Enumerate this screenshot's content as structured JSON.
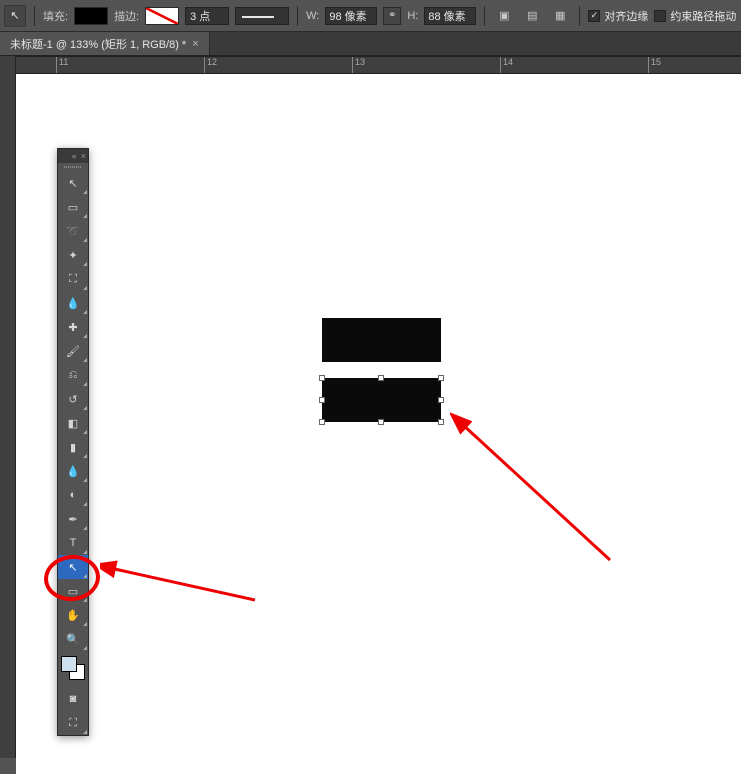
{
  "options": {
    "fill_label": "填充:",
    "stroke_label": "描边:",
    "stroke_width_value": "3 点",
    "w_label": "W:",
    "w_value": "98 像素",
    "h_label": "H:",
    "h_value": "88 像素",
    "align_edges_label": "对齐边缘",
    "align_edges_checked": true,
    "constrain_label": "约束路径拖动",
    "constrain_checked": false
  },
  "tab": {
    "title": "未标题-1 @ 133% (矩形 1, RGB/8) *"
  },
  "ruler": {
    "marks": [
      "11",
      "12",
      "13",
      "14",
      "15"
    ]
  },
  "tools": [
    {
      "name": "move-tool",
      "glyph": "↖"
    },
    {
      "name": "marquee-tool",
      "glyph": "▭"
    },
    {
      "name": "lasso-tool",
      "glyph": "➰"
    },
    {
      "name": "magic-wand-tool",
      "glyph": "✦"
    },
    {
      "name": "crop-tool",
      "glyph": "⛶"
    },
    {
      "name": "eyedropper-tool",
      "glyph": "💧"
    },
    {
      "name": "healing-brush-tool",
      "glyph": "✚"
    },
    {
      "name": "brush-tool",
      "glyph": "🖌"
    },
    {
      "name": "clone-stamp-tool",
      "glyph": "⎌"
    },
    {
      "name": "history-brush-tool",
      "glyph": "↺"
    },
    {
      "name": "eraser-tool",
      "glyph": "◧"
    },
    {
      "name": "gradient-tool",
      "glyph": "▮"
    },
    {
      "name": "blur-tool",
      "glyph": "💧"
    },
    {
      "name": "dodge-tool",
      "glyph": "◐"
    },
    {
      "name": "pen-tool",
      "glyph": "✒"
    },
    {
      "name": "type-tool",
      "glyph": "T"
    },
    {
      "name": "path-selection-tool",
      "glyph": "↖"
    },
    {
      "name": "rectangle-tool",
      "glyph": "▭"
    },
    {
      "name": "hand-tool",
      "glyph": "✋"
    },
    {
      "name": "zoom-tool",
      "glyph": "🔍"
    }
  ],
  "active_tool_index": 16
}
